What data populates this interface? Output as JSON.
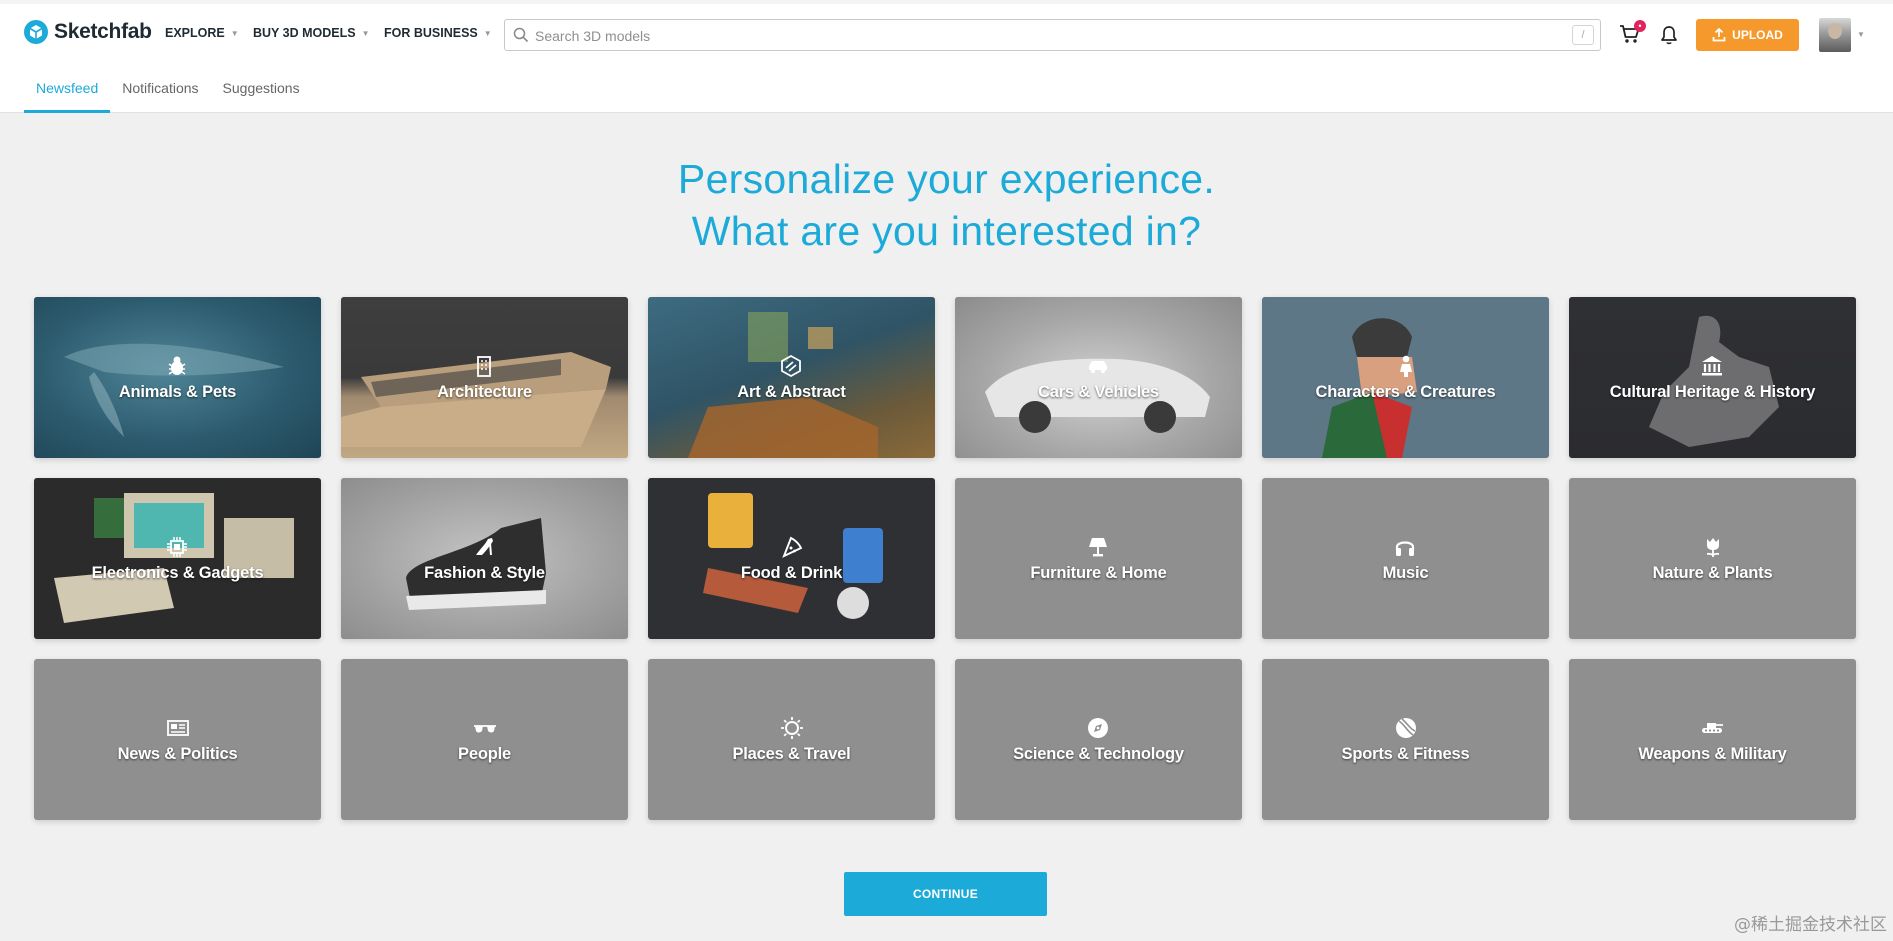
{
  "header": {
    "logo_text": "Sketchfab",
    "nav": [
      {
        "label": "EXPLORE"
      },
      {
        "label": "BUY 3D MODELS"
      },
      {
        "label": "FOR BUSINESS"
      }
    ],
    "search": {
      "placeholder": "Search 3D models",
      "shortcut": "/"
    },
    "cart_badge": "•",
    "upload_label": "UPLOAD"
  },
  "tabs": [
    {
      "label": "Newsfeed",
      "active": true
    },
    {
      "label": "Notifications",
      "active": false
    },
    {
      "label": "Suggestions",
      "active": false
    }
  ],
  "heading": {
    "line1": "Personalize your experience.",
    "line2": "What are you interested in?"
  },
  "categories": [
    {
      "label": "Animals & Pets",
      "icon": "bug-icon"
    },
    {
      "label": "Architecture",
      "icon": "building-icon"
    },
    {
      "label": "Art & Abstract",
      "icon": "abstract-icon"
    },
    {
      "label": "Cars & Vehicles",
      "icon": "car-icon"
    },
    {
      "label": "Characters & Creatures",
      "icon": "person-icon"
    },
    {
      "label": "Cultural Heritage & History",
      "icon": "museum-icon"
    },
    {
      "label": "Electronics & Gadgets",
      "icon": "chip-icon"
    },
    {
      "label": "Fashion & Style",
      "icon": "high-heel-icon"
    },
    {
      "label": "Food & Drink",
      "icon": "pizza-icon"
    },
    {
      "label": "Furniture & Home",
      "icon": "lamp-icon"
    },
    {
      "label": "Music",
      "icon": "headphones-icon"
    },
    {
      "label": "Nature & Plants",
      "icon": "tulip-icon"
    },
    {
      "label": "News & Politics",
      "icon": "newspaper-icon"
    },
    {
      "label": "People",
      "icon": "sunglasses-icon"
    },
    {
      "label": "Places & Travel",
      "icon": "sun-icon"
    },
    {
      "label": "Science & Technology",
      "icon": "compass-icon"
    },
    {
      "label": "Sports & Fitness",
      "icon": "ball-icon"
    },
    {
      "label": "Weapons & Military",
      "icon": "tank-icon"
    }
  ],
  "continue_label": "CONTINUE",
  "watermark": "@稀土掘金技术社区",
  "colors": {
    "accent": "#1caad9",
    "upload": "#f5992c",
    "card_placeholder": "#8f8f8f"
  }
}
